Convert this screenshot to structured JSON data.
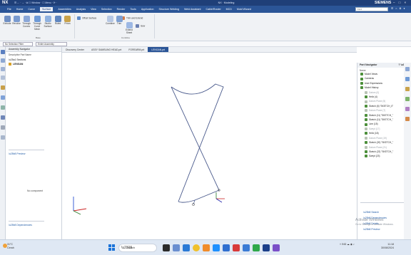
{
  "titlebar": {
    "logo": "NX",
    "quick_access": "☰ ← · → · ⧉ ☐ Window · ☐ Menu · ⟳ ·",
    "center_title": "NX · Modeling",
    "brand": "SIEMENS",
    "window_controls": "– □ ×"
  },
  "menu": {
    "items": [
      "File",
      "Home",
      "Curve",
      "Surface",
      "Assemblies",
      "Analysis",
      "View",
      "Selection",
      "Render",
      "Tools",
      "Application",
      "Structure Welding",
      "Weld Assistant",
      "Cable/Router",
      "MCD",
      "Mold Wizard"
    ],
    "active": "Surface",
    "command_finder": "Find",
    "right_icons": "☰ ⌂ ⚙ ▾"
  },
  "ribbon": {
    "big": [
      "Extrude",
      "Revolve",
      "Through Curves",
      "Through Curve Mesh",
      "Studio Surface",
      "Ruled",
      "Prism"
    ],
    "base_group": "Base",
    "small": [
      "Offset Surface",
      "Trim and Extend",
      "Combine",
      "Trim",
      "Extend Sheet",
      "Sew"
    ],
    "combine_group": "Combine"
  },
  "filter": {
    "type": "No Selection Filter",
    "scope": "Entire Assembly"
  },
  "nav": {
    "header": "Assembly Navigator",
    "col": "Descriptive Part Name",
    "rows": [
      "Sections",
      "LENGAN"
    ],
    "preview": "Preview",
    "no_component": "No component",
    "dependencies": "Dependencies"
  },
  "tabs": [
    "Discovery Center",
    "ASSY SAMSUNG HEAD.prt",
    "FOREARM.prt",
    "LENGAN.prt"
  ],
  "active_tab": "LENGAN.prt",
  "part_nav": {
    "header": "Part Navigator",
    "name_col": "Name",
    "tree": [
      {
        "label": "Model Views",
        "dim": false
      },
      {
        "label": "Cameras",
        "dim": false
      },
      {
        "label": "User Expressions",
        "dim": false
      },
      {
        "label": "Model History",
        "dim": false
      },
      {
        "label": "Datum (0)",
        "dim": true
      },
      {
        "label": "Helix (4)",
        "dim": false
      },
      {
        "label": "Datum Plane (5)",
        "dim": true
      },
      {
        "label": "Sketch (6) \"SKETCH_0\"",
        "dim": false
      },
      {
        "label": "Datum Plane (7)",
        "dim": true
      },
      {
        "label": "Sketch (11) \"SKETCH_\"",
        "dim": false
      },
      {
        "label": "Sketch (11) \"SKETCH_\"",
        "dim": false
      },
      {
        "label": "Line (15)",
        "dim": false
      },
      {
        "label": "Swept (17)",
        "dim": true
      },
      {
        "label": "Helix (18)",
        "dim": false
      },
      {
        "label": "Datum Plane (19)",
        "dim": true
      },
      {
        "label": "Sketch (20) \"SKETCH_\"",
        "dim": false
      },
      {
        "label": "Datum Plane (21)",
        "dim": true
      },
      {
        "label": "Sketch (22) \"SKETCH_\"",
        "dim": false
      },
      {
        "label": "Swept (23)",
        "dim": false
      }
    ],
    "bottom": [
      "Search",
      "Dependencies",
      "Details",
      "Preview"
    ]
  },
  "watermark": {
    "line1": "Activate Windows",
    "line2": "Go to Settings to activate Windows."
  },
  "taskbar": {
    "temp": "31°C",
    "cond": "Cerah",
    "search": "Search",
    "tray": "˄ IND ☁ ◉ ♪",
    "lang": "IND",
    "time": "11:18",
    "date": "30/08/2024"
  },
  "colors": {
    "titlebar": "#1f3f78",
    "menubar": "#2b5597",
    "accent": "#2b5597",
    "geometry": "#4a5a8c",
    "history_ok": "#4c8f3a"
  }
}
